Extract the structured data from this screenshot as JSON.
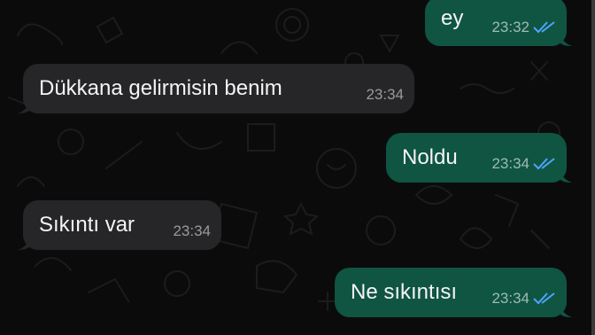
{
  "chat": {
    "colors": {
      "background": "#0b0b0b",
      "incoming_bubble": "#262628",
      "outgoing_bubble": "#0f5541",
      "read_ticks": "#4fa3ff"
    },
    "messages": [
      {
        "direction": "outgoing",
        "text": "ey",
        "time": "23:32",
        "status_icon": "double-check-read-icon"
      },
      {
        "direction": "incoming",
        "text": "Dükkana gelirmisin benim",
        "time": "23:34"
      },
      {
        "direction": "outgoing",
        "text": "Noldu",
        "time": "23:34",
        "status_icon": "double-check-read-icon"
      },
      {
        "direction": "incoming",
        "text": "Sıkıntı var",
        "time": "23:34"
      },
      {
        "direction": "outgoing",
        "text": "Ne sıkıntısı",
        "time": "23:34",
        "status_icon": "double-check-read-icon"
      }
    ]
  }
}
